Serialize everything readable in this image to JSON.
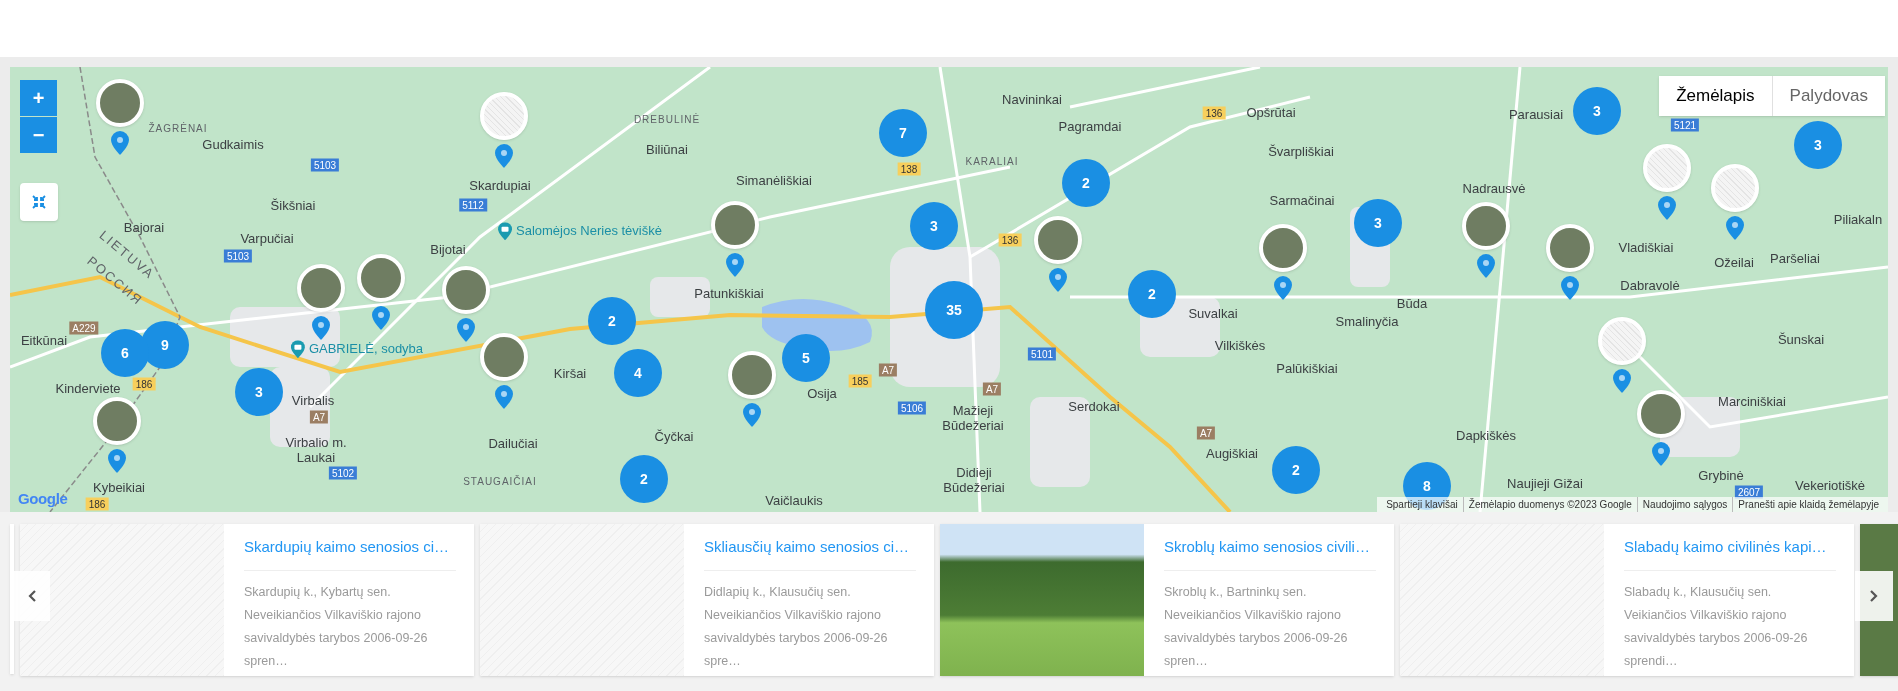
{
  "map": {
    "type_toggle": [
      {
        "label": "Žemėlapis",
        "selected": true
      },
      {
        "label": "Palydovas",
        "selected": false
      }
    ],
    "zoom_in": "+",
    "zoom_out": "−",
    "places": [
      {
        "label": "ŽAGRĖNAI",
        "kind": "area"
      },
      {
        "label": "Gudkaimis",
        "kind": "town"
      },
      {
        "label": "DREBULINĖ",
        "kind": "area"
      },
      {
        "label": "Biliūnai",
        "kind": "town"
      },
      {
        "label": "Skardupiai",
        "kind": "town"
      },
      {
        "label": "Simanėliškiai",
        "kind": "town"
      },
      {
        "label": "Šikšniai",
        "kind": "town"
      },
      {
        "label": "Bajorai",
        "kind": "town"
      },
      {
        "label": "Varpučiai",
        "kind": "town"
      },
      {
        "label": "Salomėjos Neries tėviškė",
        "kind": "poi"
      },
      {
        "label": "Bijotai",
        "kind": "town"
      },
      {
        "label": "LIETUVA",
        "kind": "country"
      },
      {
        "label": "РОССИЯ",
        "kind": "country"
      },
      {
        "label": "Patunkiškiai",
        "kind": "town"
      },
      {
        "label": "Eitkūnai",
        "kind": "town"
      },
      {
        "label": "GABRIELĖ, sodyba",
        "kind": "poi"
      },
      {
        "label": "Kiršai",
        "kind": "town"
      },
      {
        "label": "Osija",
        "kind": "town"
      },
      {
        "label": "Kinderviete",
        "kind": "town"
      },
      {
        "label": "Virbalis",
        "kind": "town"
      },
      {
        "label": "Čyčkai",
        "kind": "town"
      },
      {
        "label": "Virbalio m. Laukai",
        "kind": "town"
      },
      {
        "label": "Dailučiai",
        "kind": "town"
      },
      {
        "label": "STAUGAIČIAI",
        "kind": "area"
      },
      {
        "label": "Kybeikiai",
        "kind": "town"
      },
      {
        "label": "Vaičlaukis",
        "kind": "town"
      },
      {
        "label": "Navininkai",
        "kind": "town"
      },
      {
        "label": "Opšrūtai",
        "kind": "town"
      },
      {
        "label": "Pagramdai",
        "kind": "town"
      },
      {
        "label": "Švarpliškiai",
        "kind": "town"
      },
      {
        "label": "KARALIAI",
        "kind": "area"
      },
      {
        "label": "Nadrausvė",
        "kind": "town"
      },
      {
        "label": "Sarmačinai",
        "kind": "town"
      },
      {
        "label": "Piliakaln",
        "kind": "town"
      },
      {
        "label": "Vladiškiai",
        "kind": "town"
      },
      {
        "label": "Paršeliai",
        "kind": "town"
      },
      {
        "label": "Ožeilai",
        "kind": "town"
      },
      {
        "label": "Dabravolė",
        "kind": "town"
      },
      {
        "label": "Būda",
        "kind": "town"
      },
      {
        "label": "Suvalkai",
        "kind": "town"
      },
      {
        "label": "Smalinyčia",
        "kind": "town"
      },
      {
        "label": "Šunskai",
        "kind": "town"
      },
      {
        "label": "Vilkiškės",
        "kind": "town"
      },
      {
        "label": "Palūkiškiai",
        "kind": "town"
      },
      {
        "label": "Marciniškiai",
        "kind": "town"
      },
      {
        "label": "Serdokai",
        "kind": "town"
      },
      {
        "label": "Mažieji Būdežeriai",
        "kind": "town"
      },
      {
        "label": "Dapkiškės",
        "kind": "town"
      },
      {
        "label": "Augiškiai",
        "kind": "town"
      },
      {
        "label": "Didieji Būdežeriai",
        "kind": "town"
      },
      {
        "label": "Grybinė",
        "kind": "town"
      },
      {
        "label": "Naujieji Gižai",
        "kind": "town"
      },
      {
        "label": "Vekeriotiškė",
        "kind": "town"
      },
      {
        "label": "Parausiai",
        "kind": "town"
      },
      {
        "label": "5103",
        "kind": "road_local"
      },
      {
        "label": "5112",
        "kind": "road_local"
      },
      {
        "label": "5103",
        "kind": "road_local"
      },
      {
        "label": "A229",
        "kind": "road_main"
      },
      {
        "label": "186",
        "kind": "road_regional"
      },
      {
        "label": "A7",
        "kind": "road_main"
      },
      {
        "label": "5102",
        "kind": "road_local"
      },
      {
        "label": "186",
        "kind": "road_regional"
      },
      {
        "label": "138",
        "kind": "road_regional"
      },
      {
        "label": "A7",
        "kind": "road_main"
      },
      {
        "label": "185",
        "kind": "road_regional"
      },
      {
        "label": "5106",
        "kind": "road_local"
      },
      {
        "label": "136",
        "kind": "road_regional"
      },
      {
        "label": "136",
        "kind": "road_regional"
      },
      {
        "label": "5101",
        "kind": "road_local"
      },
      {
        "label": "A7",
        "kind": "road_main"
      },
      {
        "label": "A7",
        "kind": "road_main"
      },
      {
        "label": "5121",
        "kind": "road_local"
      },
      {
        "label": "2607",
        "kind": "road_local"
      }
    ],
    "clusters": [
      "7",
      "3",
      "2",
      "35",
      "2",
      "4",
      "5",
      "9",
      "6",
      "3",
      "2",
      "2",
      "3",
      "2",
      "8",
      "3",
      "3"
    ],
    "logo": "Google",
    "attribution": [
      "Spartieji klavišai",
      "Žemėlapio duomenys ©2023 Google",
      "Naudojimo sąlygos",
      "Pranešti apie klaidą žemėlapyje"
    ]
  },
  "carousel": {
    "cards": [
      {
        "title": "Skardupių kaimo senosios ci…",
        "description": "Skardupių k., Kybartų sen. Neveikiančios Vilkaviškio rajono savivaldybės tarybos 2006-09-26 spren…",
        "has_photo": false
      },
      {
        "title": "Skliausčių kaimo senosios ci…",
        "description": "Didlapių k., Klausučių sen. Neveikiančios Vilkaviškio rajono savivaldybės tarybos 2006-09-26 spre…",
        "has_photo": false
      },
      {
        "title": "Skroblų kaimo senosios civili…",
        "description": "Skroblų k., Bartninkų sen. Neveikiančios Vilkaviškio rajono savivaldybės tarybos 2006-09-26 spren…",
        "has_photo": true
      },
      {
        "title": "Slabadų kaimo civilinės kapi…",
        "description": "Slabadų k., Klausučių sen. Veikiančios Vilkaviškio rajono savivaldybės tarybos 2006-09-26 sprendi…",
        "has_photo": false
      }
    ]
  }
}
